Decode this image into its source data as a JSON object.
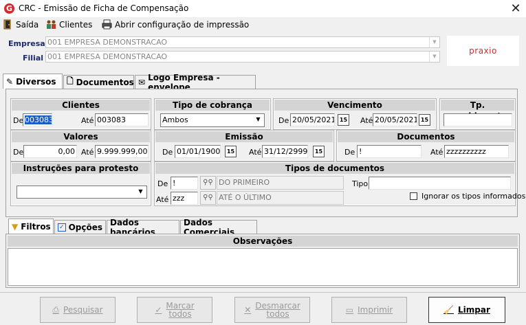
{
  "window": {
    "title": "CRC - Emissão de Ficha de Compensação",
    "app_icon": "G"
  },
  "menu": {
    "saida": "Saída",
    "clientes": "Clientes",
    "abrir_config": "Abrir configuração de impressão"
  },
  "header": {
    "empresa_label": "Empresa",
    "empresa_value": "001 EMPRESA DEMONSTRACAO",
    "filial_label": "Filial",
    "filial_value": "001 EMPRESA DEMONSTRACAO",
    "logo_text": "praxio"
  },
  "tabs_top": [
    "Diversos",
    "Documentos",
    "Logo Empresa - envelope"
  ],
  "clientes": {
    "title": "Clientes",
    "de_label": "De",
    "de_value": "003083",
    "ate_label": "Até",
    "ate_value": "003083"
  },
  "tipo_cobranca": {
    "title": "Tipo de cobrança",
    "value": "Ambos"
  },
  "vencimento": {
    "title": "Vencimento",
    "de_label": "De",
    "de_value": "20/05/2021",
    "ate_label": "Até",
    "ate_value": "20/05/2021"
  },
  "tp_recebimento": {
    "title": "Tp. recebimento",
    "value": ""
  },
  "valores": {
    "title": "Valores",
    "de_label": "De",
    "de_value": "0,00",
    "ate_label": "Até",
    "ate_value": "9.999.999,00"
  },
  "emissao": {
    "title": "Emissão",
    "de_label": "De",
    "de_value": "01/01/1900",
    "ate_label": "Até",
    "ate_value": "31/12/2999"
  },
  "documentos": {
    "title": "Documentos",
    "de_label": "De",
    "de_value": "!",
    "ate_label": "Até",
    "ate_value": "zzzzzzzzzz"
  },
  "instrucoes": {
    "title": "Instruções para protesto",
    "value": ""
  },
  "tipos_documentos": {
    "title": "Tipos de documentos",
    "de_label": "De",
    "de_value": "!",
    "de_desc": "DO PRIMEIRO",
    "ate_label": "Até",
    "ate_value": "zzz",
    "ate_desc": "ATÉ O ÚLTIMO",
    "tipo_label": "Tipo",
    "tipo_value": "",
    "ignorar_label": "Ignorar os tipos informados"
  },
  "tabs_bottom": [
    "Filtros",
    "Opções",
    "Dados bancários",
    "Dados Comerciais"
  ],
  "observacoes": {
    "title": "Observações"
  },
  "buttons": {
    "pesquisar": "Pesquisar",
    "marcar_1": "Marcar",
    "marcar_2": "todos",
    "desmarcar_1": "Desmarcar",
    "desmarcar_2": "todos",
    "imprimir": "Imprimir",
    "limpar": "Limpar"
  },
  "colors": {
    "label_blue": "#1a2a6c",
    "logo_red": "#d9272e",
    "selection": "#1c5cc8"
  }
}
